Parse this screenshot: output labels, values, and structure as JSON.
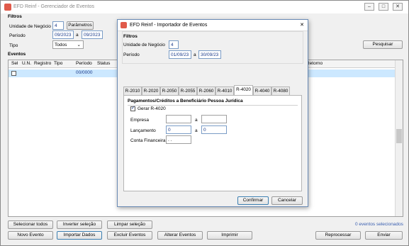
{
  "main_window": {
    "title": "EFD Reinf - Gerenciador de Eventos",
    "filtros_title": "Filtros",
    "unidade_label": "Unidade de Negócio",
    "unidade_value": "4",
    "parametros_button": "Parâmetros",
    "periodo_label": "Período",
    "periodo_from": "09/2023",
    "periodo_sep": "a",
    "periodo_to": "09/2023",
    "tipo_label": "Tipo",
    "tipo_value": "Todos",
    "pesquisar_button": "Pesquisar",
    "eventos_title": "Eventos",
    "columns": [
      "Sel",
      "U.N.",
      "Registro",
      "Tipo",
      "Período",
      "Status"
    ],
    "retorno_col": "Retorno",
    "row_periodo": "00/0000",
    "selecionar_todos": "Selecionar todos",
    "inverter_selecao": "Inverter seleção",
    "limpar_selecao": "Limpar seleção",
    "eventos_selecionados": "0 eventos selecionados",
    "novo_evento": "Novo Evento",
    "importar_dados": "Importar Dados",
    "excluir_eventos": "Excluir Eventos",
    "alterar_eventos": "Alterar Eventos",
    "imprimir": "Imprimir",
    "reprocessar": "Reprocessar",
    "enviar": "Enviar"
  },
  "dialog": {
    "title": "EFD Reinf - Importador de Eventos",
    "filtros_title": "Filtros",
    "unidade_label": "Unidade de Negócio",
    "unidade_value": "4",
    "periodo_label": "Período",
    "periodo_from": "01/09/23",
    "periodo_sep": "a",
    "periodo_to": "30/09/23",
    "tabs": [
      "R-2010",
      "R-2020",
      "R-2050",
      "R-2055",
      "R-2060",
      "R-4010",
      "R-4020",
      "R-4040",
      "R-4080"
    ],
    "active_tab": "R-4020",
    "section_title": "Pagamentos/Créditos a Beneficiário Pessoa Jurídica",
    "gerar_label": "Gerar R-4020",
    "gerar_checked": true,
    "empresa_label": "Empresa",
    "empresa_sep": "a",
    "lancamento_label": "Lançamento",
    "lancamento_from": "0",
    "lancamento_sep": "a",
    "lancamento_to": "0",
    "conta_label": "Conta Financeira",
    "conta_value": ". .",
    "confirmar": "Confirmar",
    "cancelar": "Cancelar"
  },
  "colors": {
    "selected_row": "#cce8ff",
    "accent": "#3c7fb1",
    "status_text": "#1a3a8a"
  }
}
